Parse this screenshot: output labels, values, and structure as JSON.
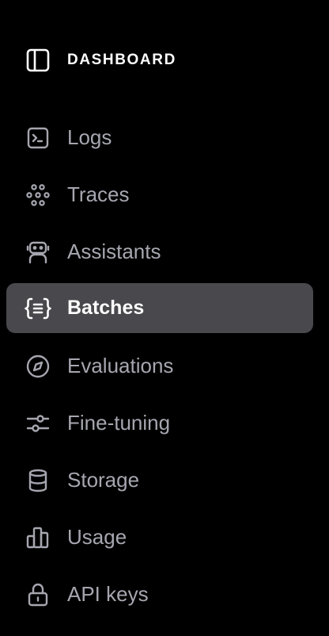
{
  "header": {
    "title": "DASHBOARD",
    "icon": "sidebar-panel-icon"
  },
  "nav": {
    "items": [
      {
        "label": "Logs",
        "icon": "terminal-icon",
        "active": false
      },
      {
        "label": "Traces",
        "icon": "traces-icon",
        "active": false
      },
      {
        "label": "Assistants",
        "icon": "robot-icon",
        "active": false
      },
      {
        "label": "Batches",
        "icon": "braces-list-icon",
        "active": true
      },
      {
        "label": "Evaluations",
        "icon": "compass-icon",
        "active": false
      },
      {
        "label": "Fine-tuning",
        "icon": "sliders-icon",
        "active": false
      },
      {
        "label": "Storage",
        "icon": "database-icon",
        "active": false
      },
      {
        "label": "Usage",
        "icon": "bar-chart-icon",
        "active": false
      },
      {
        "label": "API keys",
        "icon": "lock-icon",
        "active": false
      }
    ]
  },
  "colors": {
    "background": "#000000",
    "active_background": "#48484d",
    "text_muted": "#a6a6b0",
    "text_active": "#ffffff"
  }
}
